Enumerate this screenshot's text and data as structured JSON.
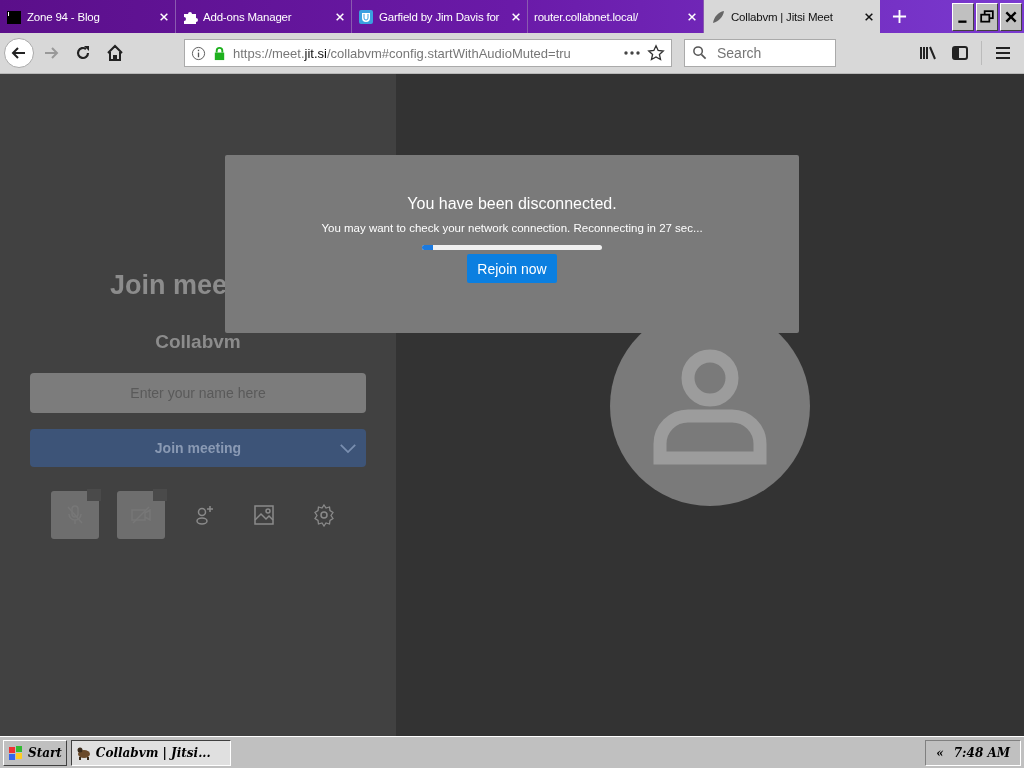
{
  "tabs": [
    {
      "title": "Zone 94 - Blog",
      "selected": false
    },
    {
      "title": "Add-ons Manager",
      "selected": false
    },
    {
      "title": "Garfield by Jim Davis for",
      "selected": false
    },
    {
      "title": "router.collabnet.local/",
      "selected": false
    },
    {
      "title": "Collabvm | Jitsi Meet",
      "selected": true
    }
  ],
  "navigation": {
    "forward_disabled": true
  },
  "url": {
    "prefix": "https://meet.",
    "domain": "jit.si",
    "path": "/collabvm#config.startWithAudioMuted=tru"
  },
  "search": {
    "placeholder": "Search"
  },
  "prejoin": {
    "heading": "Join mee",
    "room": "Collabvm",
    "name_field": {
      "placeholder": "Enter your name here"
    },
    "join_button": "Join meeting",
    "devices": [
      {
        "kind": "microphone",
        "muted": true
      },
      {
        "kind": "camera",
        "muted": true
      }
    ]
  },
  "dialog": {
    "title": "You have been disconnected.",
    "message": "You may want to check your network connection. Reconnecting in 27 sec...",
    "progress": {
      "level": 0.06
    },
    "button": "Rejoin now"
  },
  "taskbar": {
    "start": "Start",
    "tasks": [
      {
        "label": "Collabvm | Jitsi...",
        "selected": true
      }
    ],
    "tray_toggle": "«",
    "clock": "7:48 AM"
  }
}
